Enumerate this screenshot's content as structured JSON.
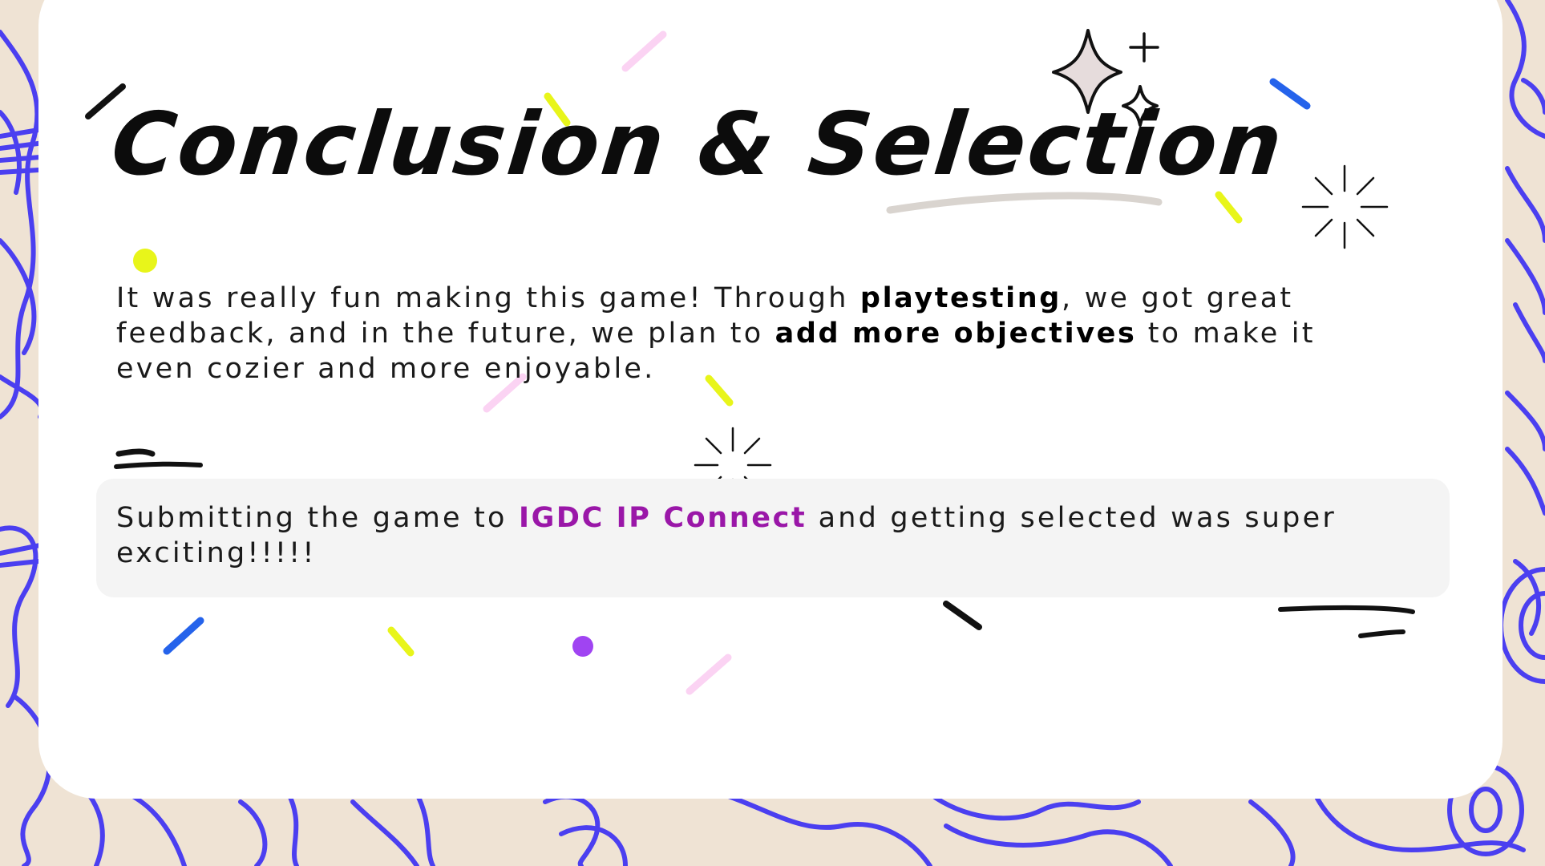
{
  "slide": {
    "title": "Conclusion & Selection",
    "paragraph": {
      "part1": "It was really fun making this game! Through ",
      "bold1": "playtesting",
      "part2": ", we got great feedback, and in the future, we plan to ",
      "bold2": "add more objectives",
      "part3": " to make it even cozier and more enjoyable."
    },
    "callout": {
      "part1": "Submitting the game to ",
      "highlight": "IGDC IP Connect",
      "part2": " and getting selected was super exciting!!!!!"
    }
  },
  "colors": {
    "background": "#efe3d4",
    "contour_lines": "#4b3ff0",
    "card": "#ffffff",
    "callout_bg": "#f4f4f4",
    "highlight": "#9a17a8",
    "confetti_yellow": "#e8f51a",
    "confetti_blue": "#2563eb",
    "confetti_pink": "#fbd3f3",
    "confetti_purple": "#a044f2",
    "sparkle_fill": "#e6dcdc"
  },
  "icons": [
    "four-point-star-icon",
    "plus-sparkle-icon",
    "small-star-icon",
    "burst-icon"
  ]
}
